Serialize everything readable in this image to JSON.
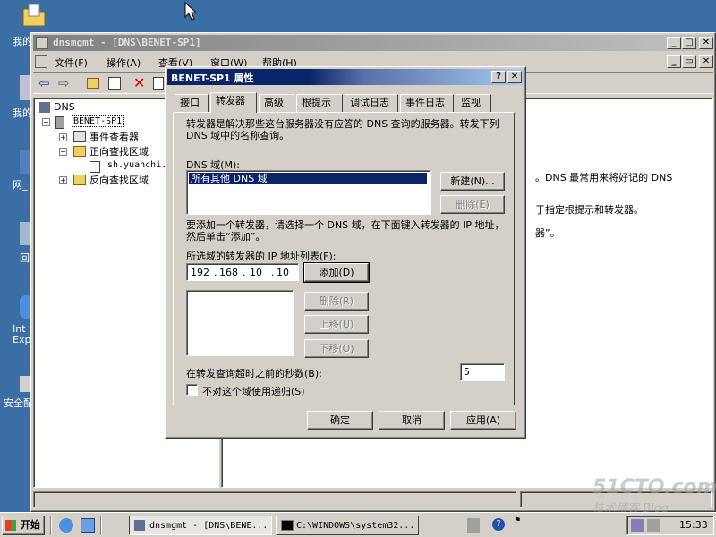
{
  "desktop": {
    "icons": [
      {
        "label": "我的"
      },
      {
        "label": "我的"
      },
      {
        "label": "网_"
      },
      {
        "label": "回"
      },
      {
        "label": "Int Exp"
      },
      {
        "label": "安全配"
      }
    ]
  },
  "mmc": {
    "title": "dnsmgmt - [DNS\\BENET-SP1]",
    "menu": [
      "文件(F)",
      "操作(A)",
      "查看(V)",
      "窗口(W)",
      "帮助(H)"
    ],
    "tree": {
      "root": "DNS",
      "server": "BENET-SP1",
      "event_viewer": "事件查看器",
      "forward_zones": "正向查找区域",
      "zone_item": "sh.yuanchi.",
      "reverse_zones": "反向查找区域"
    },
    "right_text": [
      "。DNS 最常用来将好记的 DNS",
      "于指定根提示和转发器。",
      "器”。"
    ]
  },
  "dialog": {
    "title": "BENET-SP1 属性",
    "tabs": [
      "接口",
      "转发器",
      "高级",
      "根提示",
      "调试日志",
      "事件日志",
      "监视"
    ],
    "active_tab": "转发器",
    "description": "转发器是解决那些这台服务器没有应答的 DNS 查询的服务器。转发下列 DNS 域中的名称查询。",
    "dns_domain_label": "DNS 域(M):",
    "dns_domains": [
      "所有其他 DNS 域"
    ],
    "new_button": "新建(N)...",
    "remove_domain_button": "删除(E)",
    "instructions": "要添加一个转发器，请选择一个 DNS 域，在下面键入转发器的 IP 地址，然后单击“添加”。",
    "ip_list_label": "所选域的转发器的 IP 地址列表(F):",
    "ip_octets": [
      "192",
      "168",
      "10",
      "10"
    ],
    "add_button": "添加(D)",
    "remove_button": "删除(R)",
    "move_up_button": "上移(U)",
    "move_down_button": "下移(O)",
    "timeout_label": "在转发查询超时之前的秒数(B):",
    "timeout_value": "5",
    "no_recursion_label": "不对这个域使用递归(S)",
    "ok": "确定",
    "cancel": "取消",
    "apply": "应用(A)"
  },
  "taskbar": {
    "start": "开始",
    "tasks": [
      "dnsmgmt - [DNS\\BENE...",
      "C:\\WINDOWS\\system32..."
    ],
    "clock": "15:33"
  },
  "watermark": {
    "line1": "51CTO.com",
    "line2": "技术博客  Blog"
  }
}
